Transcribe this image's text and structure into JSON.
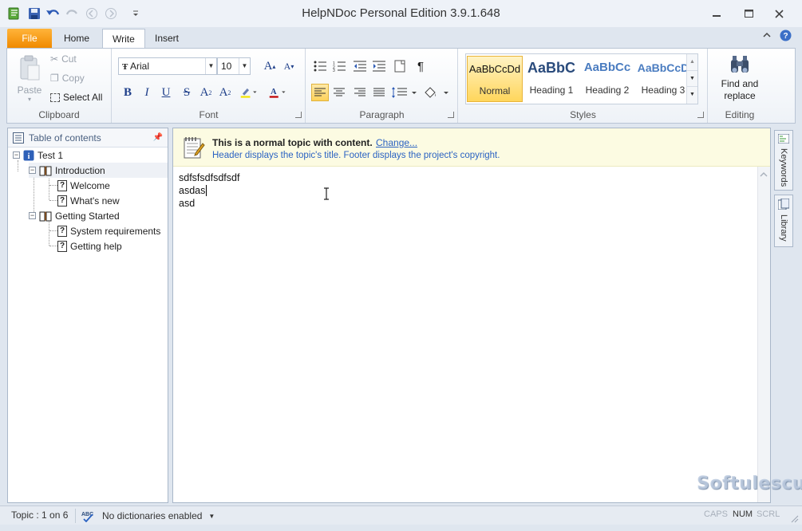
{
  "app": {
    "title": "HelpNDoc Personal Edition 3.9.1.648"
  },
  "ribbon_tabs": [
    {
      "label": "File"
    },
    {
      "label": "Home"
    },
    {
      "label": "Write"
    },
    {
      "label": "Insert"
    }
  ],
  "clipboard": {
    "paste": "Paste",
    "cut": "Cut",
    "copy": "Copy",
    "select_all": "Select All",
    "label": "Clipboard"
  },
  "font": {
    "family": "Arial",
    "size": "10",
    "label": "Font",
    "bold": "B",
    "italic": "I",
    "underline": "U",
    "strike": "S",
    "subscript": "A",
    "superscript": "A",
    "font_color": "A",
    "grow": "A",
    "shrink": "A"
  },
  "paragraph": {
    "label": "Paragraph",
    "pilcrow": "¶"
  },
  "styles": {
    "label": "Styles",
    "items": [
      {
        "sample": "AaBbCcDd",
        "name": "Normal"
      },
      {
        "sample": "AaBbC",
        "name": "Heading 1"
      },
      {
        "sample": "AaBbCc",
        "name": "Heading 2"
      },
      {
        "sample": "AaBbCcD",
        "name": "Heading 3"
      }
    ]
  },
  "editing": {
    "find_replace": "Find and replace",
    "find_line1": "Find and",
    "find_line2": "replace",
    "label": "Editing"
  },
  "toc": {
    "header": "Table of contents",
    "items": [
      {
        "label": "Test 1"
      },
      {
        "label": "Introduction"
      },
      {
        "label": "Welcome"
      },
      {
        "label": "What's new"
      },
      {
        "label": "Getting Started"
      },
      {
        "label": "System requirements"
      },
      {
        "label": "Getting help"
      }
    ]
  },
  "infobar": {
    "title": "This is a normal topic with content.",
    "change_link": "Change...",
    "subtitle": "Header displays the topic's title.   Footer displays the project's copyright."
  },
  "document": {
    "lines": [
      "sdfsfsdfsdfsdf",
      "asdas",
      "asd"
    ]
  },
  "side_tabs": {
    "keywords": "Keywords",
    "library": "Library"
  },
  "status": {
    "topic": "Topic : 1 on 6",
    "dictionary": "No dictionaries enabled",
    "caps": "CAPS",
    "num": "NUM",
    "scrl": "SCRL"
  },
  "watermark": "Softulescu"
}
